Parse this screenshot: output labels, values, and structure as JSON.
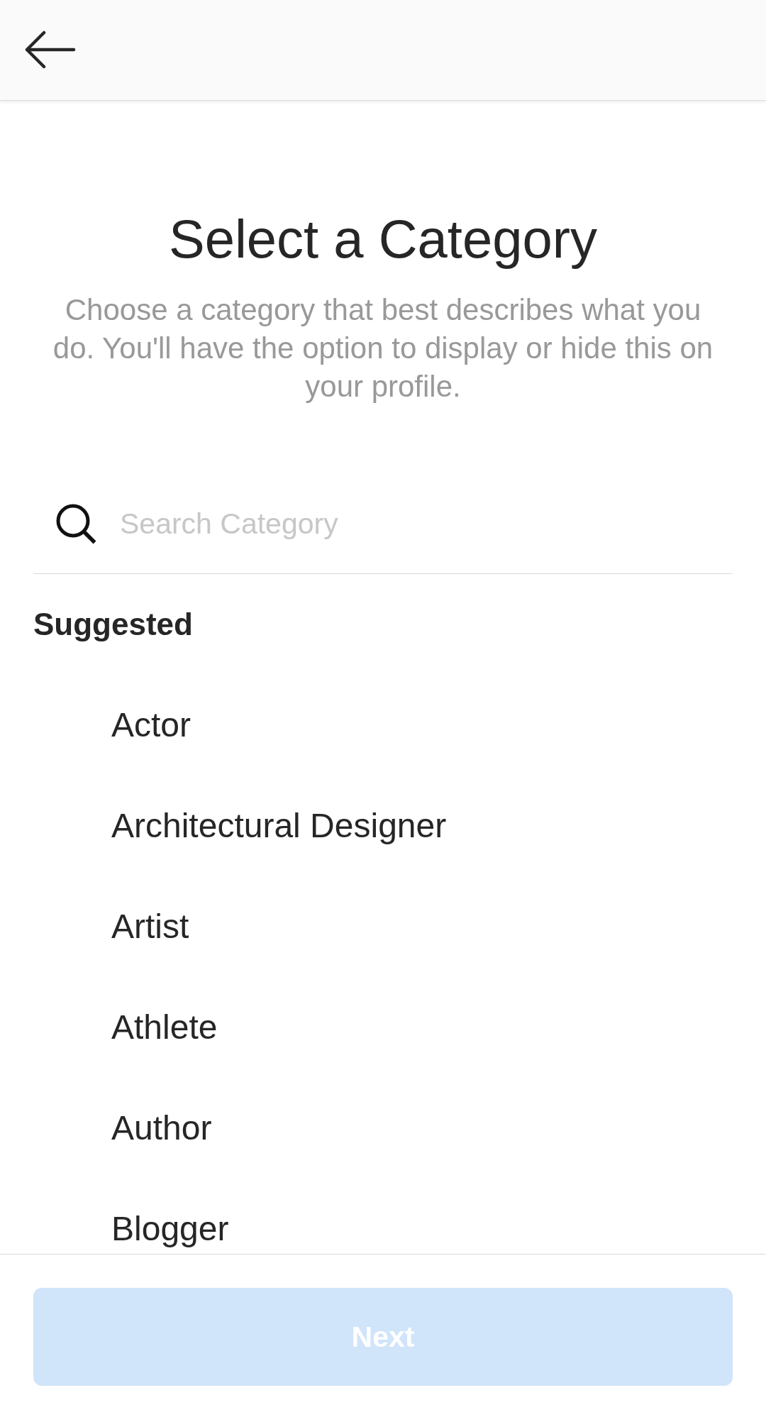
{
  "title": "Select a Category",
  "subtitle": "Choose a category that best describes what you do. You'll have the option to display or hide this on your profile.",
  "search": {
    "placeholder": "Search Category"
  },
  "suggested": {
    "heading": "Suggested",
    "items": [
      {
        "label": "Actor",
        "selected": false
      },
      {
        "label": "Architectural Designer",
        "selected": false
      },
      {
        "label": "Artist",
        "selected": false
      },
      {
        "label": "Athlete",
        "selected": false
      },
      {
        "label": "Author",
        "selected": false
      },
      {
        "label": "Blogger",
        "selected": false
      }
    ]
  },
  "next_button": {
    "label": "Next",
    "disabled": true
  }
}
